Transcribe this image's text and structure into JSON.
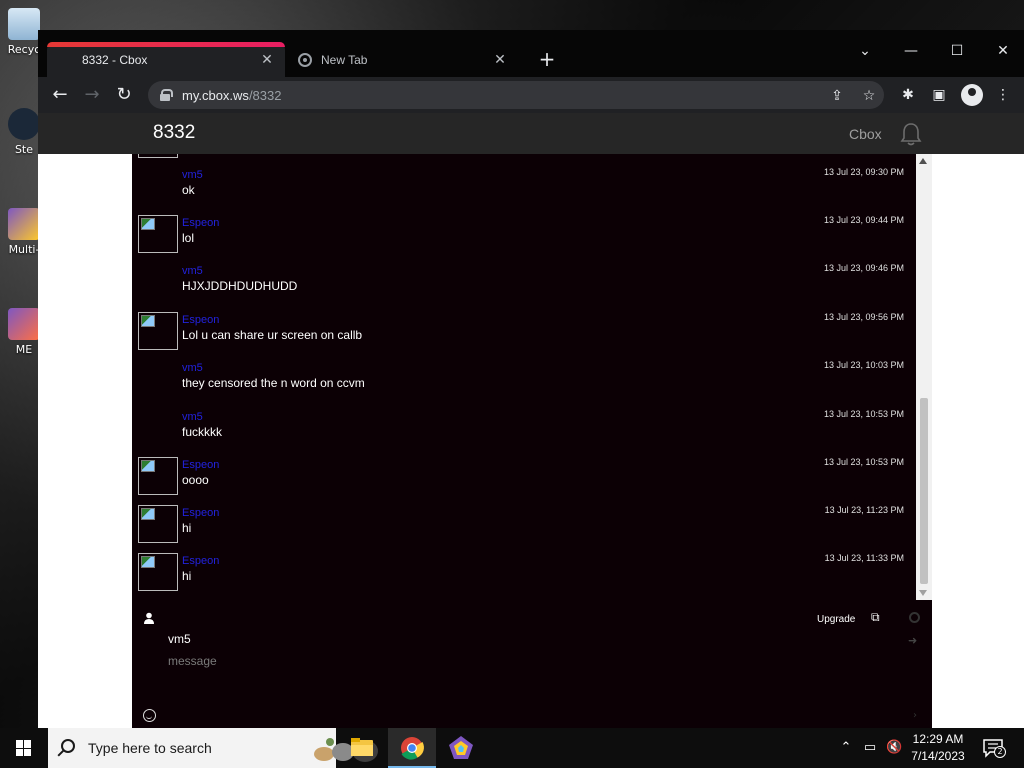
{
  "desktop": {
    "icons": [
      {
        "label": "Recyc"
      },
      {
        "label": "Ste"
      },
      {
        "label": "Multi-"
      },
      {
        "label": "ME"
      }
    ]
  },
  "browser": {
    "tabs": [
      {
        "title": "8332 - Cbox",
        "active": true
      },
      {
        "title": "New Tab",
        "active": false
      }
    ],
    "url_host": "my.cbox.ws",
    "url_path": "/8332"
  },
  "site": {
    "title": "8332",
    "brand": "Cbox"
  },
  "chat": {
    "messages": [
      {
        "name": "vm5",
        "time": "13 Jul 23, 09:30 PM",
        "text": "ok",
        "has_avatar": false
      },
      {
        "name": "Espeon",
        "time": "13 Jul 23, 09:44 PM",
        "text": "lol",
        "has_avatar": true
      },
      {
        "name": "vm5",
        "time": "13 Jul 23, 09:46 PM",
        "text": "HJXJDDHDUDHUDD",
        "has_avatar": false
      },
      {
        "name": "Espeon",
        "time": "13 Jul 23, 09:56 PM",
        "text": "Lol u can share ur screen on callb",
        "has_avatar": true
      },
      {
        "name": "vm5",
        "time": "13 Jul 23, 10:03 PM",
        "text": "they censored the n word on ccvm",
        "has_avatar": false
      },
      {
        "name": "vm5",
        "time": "13 Jul 23, 10:53 PM",
        "text": "fuckkkk",
        "has_avatar": false
      },
      {
        "name": "Espeon",
        "time": "13 Jul 23, 10:53 PM",
        "text": "oooo",
        "has_avatar": true
      },
      {
        "name": "Espeon",
        "time": "13 Jul 23, 11:23 PM",
        "text": "hi",
        "has_avatar": true
      },
      {
        "name": "Espeon",
        "time": "13 Jul 23, 11:33 PM",
        "text": "hi",
        "has_avatar": true
      }
    ],
    "compose": {
      "upgrade_label": "Upgrade",
      "name_value": "vm5",
      "message_placeholder": "message"
    }
  },
  "taskbar": {
    "search_placeholder": "Type here to search",
    "time": "12:29 AM",
    "date": "7/14/2023",
    "notification_count": "2"
  }
}
